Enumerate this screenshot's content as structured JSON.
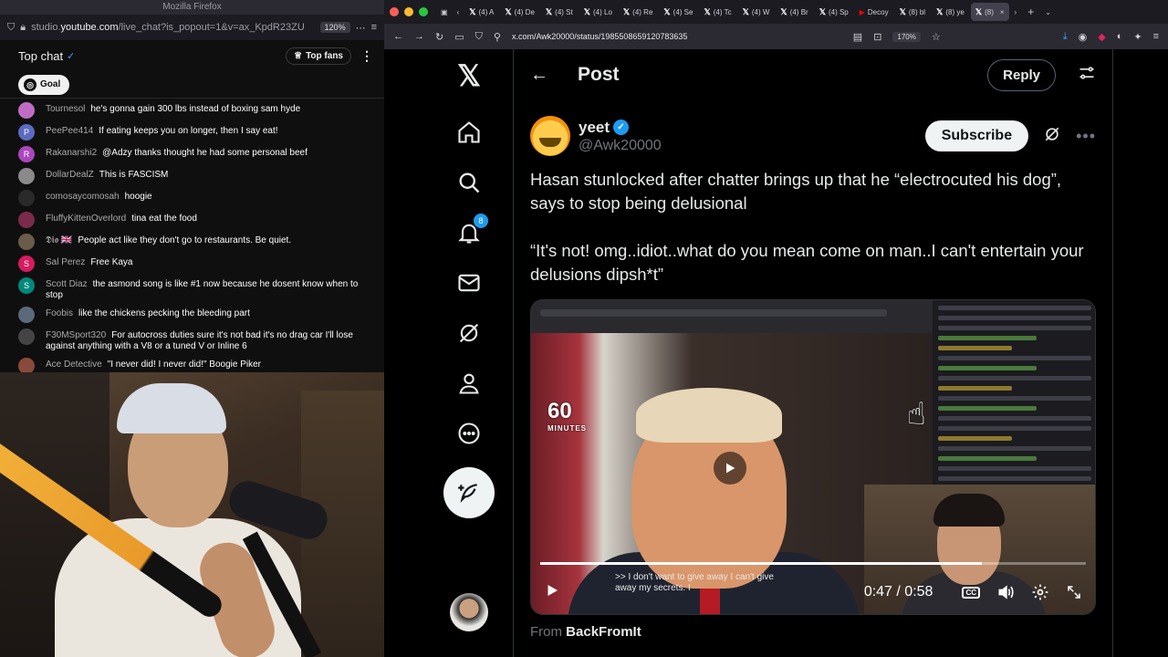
{
  "left_window": {
    "title": "Mozilla Firefox",
    "url_prefix": "studio.",
    "url_domain": "youtube.com",
    "url_path": "/live_chat?is_popout=1&v=ax_KpdR23ZU",
    "zoom": "120%",
    "chat_header": "Top chat",
    "top_fans_label": "Top fans",
    "goal_label": "Goal",
    "messages": [
      {
        "name": "Tournesol",
        "text": "he's gonna gain 300 lbs instead of boxing sam hyde",
        "color": "#c06cc6",
        "initial": ""
      },
      {
        "name": "PeePee414",
        "text": "If eating keeps you on longer, then I say eat!",
        "color": "#5c6bc0",
        "initial": "P"
      },
      {
        "name": "Rakanarshi2",
        "text": "@Adzy thanks thought he had some personal beef",
        "color": "#ab47bc",
        "initial": "R"
      },
      {
        "name": "DollarDealZ",
        "text": "This is FASCISM",
        "color": "#8a8a8a",
        "initial": ""
      },
      {
        "name": "comosaycomosah",
        "text": "hoogie",
        "color": "#2a2a2a",
        "initial": ""
      },
      {
        "name": "FluffyKittenOverlord",
        "text": "tina eat the food",
        "color": "#7a2a4a",
        "initial": ""
      },
      {
        "name": "𝕯𝖎𝖔 🇬🇧",
        "text": "People act like they don't go to restaurants. Be quiet.",
        "color": "#6b5b4b",
        "initial": ""
      },
      {
        "name": "Sal Perez",
        "text": "Free Kaya",
        "color": "#d81b60",
        "initial": "S"
      },
      {
        "name": "Scott Diaz",
        "text": "the asmond song is like #1 now because he dosent know when to stop",
        "color": "#00897b",
        "initial": "S"
      },
      {
        "name": "Foobis",
        "text": "like the chickens pecking the bleeding part",
        "color": "#5a6a7a",
        "initial": ""
      },
      {
        "name": "F30MSport320",
        "text": "For autocross duties sure it's not bad it's no drag car I'll lose against anything with a V8 or a tuned V or Inline 6",
        "color": "#444",
        "initial": ""
      },
      {
        "name": "Ace Detective",
        "text": "\"I never did! I never did!\" Boogie Piker",
        "color": "#8a4a3a",
        "initial": ""
      }
    ]
  },
  "right_window": {
    "tabs": [
      {
        "label": "(4) A",
        "icon": "x"
      },
      {
        "label": "(4) De",
        "icon": "x"
      },
      {
        "label": "(4) St",
        "icon": "x"
      },
      {
        "label": "(4) Lo",
        "icon": "x"
      },
      {
        "label": "(4) Re",
        "icon": "x"
      },
      {
        "label": "(4) Se",
        "icon": "x"
      },
      {
        "label": "(4) Tc",
        "icon": "x"
      },
      {
        "label": "(4) W",
        "icon": "x"
      },
      {
        "label": "(4) Br",
        "icon": "x"
      },
      {
        "label": "(4) Sp",
        "icon": "x"
      },
      {
        "label": "Decoy",
        "icon": "yt"
      },
      {
        "label": "(8) bl",
        "icon": "x"
      },
      {
        "label": "(8) ye",
        "icon": "x"
      },
      {
        "label": "(8)",
        "icon": "x",
        "active": true
      }
    ],
    "url": "x.com/Awk20000/status/1985508659120783635",
    "zoom": "170%",
    "notifications_badge": "8",
    "post_header_title": "Post",
    "reply_label": "Reply",
    "author_name": "yeet",
    "author_handle": "@Awk20000",
    "subscribe_label": "Subscribe",
    "post_paragraph_1": "Hasan stunlocked after chatter brings up that he “electrocuted his dog”, says to stop being delusional",
    "post_paragraph_2": "“It's not! omg..idiot..what do you mean come on man..I can't entertain your delusions dipsh*t”",
    "video": {
      "logo": "60",
      "logo_sub": "MINUTES",
      "subtitle_line_1": ">> I don't want to give away I can't give",
      "subtitle_line_2": "away my secrets. I",
      "time_current": "0:47",
      "time_total": "0:58",
      "time_display": "0:47 / 0:58",
      "progress": 0.81
    },
    "from_prefix": "From",
    "from_source": "BackFromIt"
  },
  "colors": {
    "x_blue": "#1d9bf0",
    "yt_blue": "#3ea6ff"
  }
}
